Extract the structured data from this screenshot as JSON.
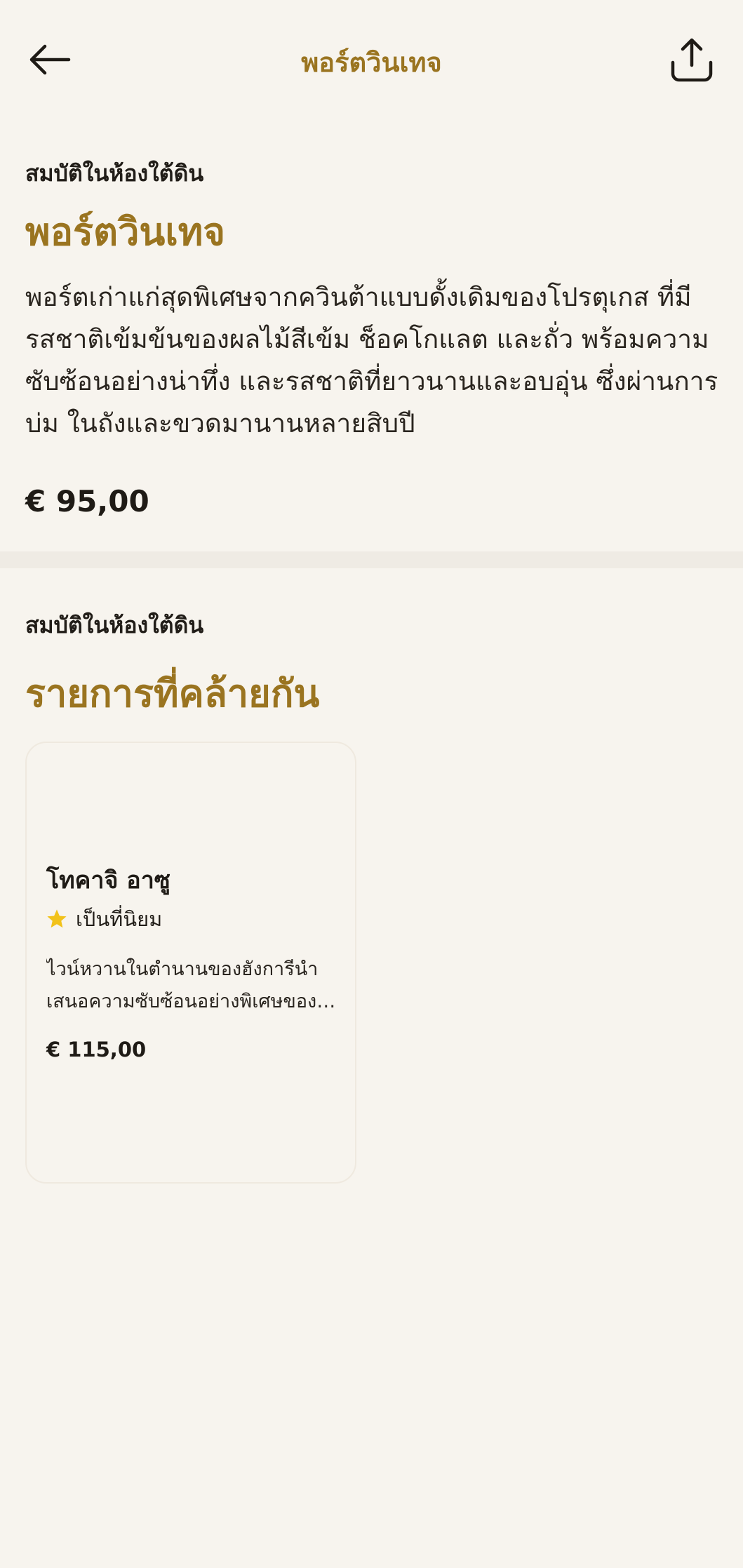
{
  "header": {
    "title": "พอร์ตวินเทจ",
    "back_icon": "arrow-left-icon",
    "share_icon": "share-icon"
  },
  "product": {
    "category": "สมบัติในห้องใต้ดิน",
    "name": "พอร์ตวินเทจ",
    "description": "พอร์ตเก่าแก่สุดพิเศษจากควินต้าแบบดั้งเดิมของโปรตุเกส ที่มีรสชาติเข้มข้นของผลไม้สีเข้ม ช็อคโกแลต และถั่ว พร้อมความซับซ้อนอย่างน่าทึ่ง และรสชาติที่ยาวนานและอบอุ่น ซึ่งผ่านการบ่ม ในถังและขวดมานานหลายสิบปี",
    "price": "€ 95,00"
  },
  "similar": {
    "category": "สมบัติในห้องใต้ดิน",
    "title": "รายการที่คล้ายกัน",
    "items": [
      {
        "name": "โทคาจิ อาซู",
        "badge": "เป็นที่นิยม",
        "badge_icon": "star-icon",
        "description": "ไวน์หวานในตำนานของฮังการีนำเสนอความซับซ้อนอย่างพิเศษของรสชาติ",
        "price": "€ 115,00"
      }
    ]
  },
  "colors": {
    "background": "#f7f4ee",
    "accent": "#9a7420",
    "star": "#f2c21a",
    "text": "#1f1b16"
  }
}
